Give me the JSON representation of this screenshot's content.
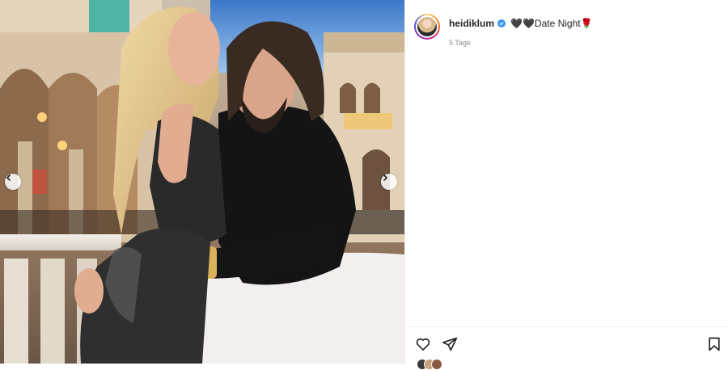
{
  "post": {
    "username": "heidiklum",
    "caption": "🖤🖤Date Night🌹",
    "timestamp": "5 Tage",
    "verified": true
  },
  "media": {
    "alt": "",
    "carousel": {
      "has_prev": true,
      "has_next": true
    }
  },
  "actions": {
    "like_icon": "heart-icon",
    "share_icon": "paper-plane-icon",
    "save_icon": "bookmark-icon"
  },
  "colors": {
    "verified_blue": "#3897f0",
    "text": "#262626",
    "muted": "#8e8e8e",
    "divider": "#efefef"
  }
}
